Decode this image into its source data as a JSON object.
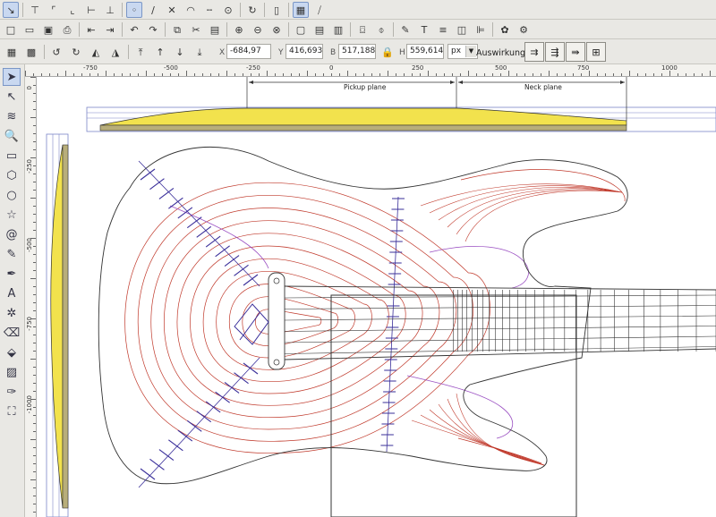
{
  "toolbar1": {
    "icons": [
      "node-snap-icon",
      "snap-bbox-icon",
      "snap-edge-icon",
      "snap-corner-icon",
      "snap-midpoint-icon",
      "snap-center-icon",
      "snap-node-icon",
      "snap-path-icon",
      "snap-intersection-icon",
      "snap-smooth-icon",
      "snap-line-midpoint-icon",
      "snap-object-center-icon",
      "snap-rotation-icon",
      "snap-page-icon",
      "snap-grid-icon",
      "snap-guide-icon"
    ]
  },
  "toolbar2": {
    "icons": [
      "new-icon",
      "open-icon",
      "save-icon",
      "print-icon",
      "import-icon",
      "export-icon",
      "undo-icon",
      "redo-icon",
      "copy-icon",
      "cut-icon",
      "paste-icon",
      "zoom-selection-icon",
      "zoom-drawing-icon",
      "zoom-page-icon",
      "duplicate-icon",
      "clone-icon",
      "unlink-clone-icon",
      "group-icon",
      "ungroup-icon",
      "fill-stroke-icon",
      "text-font-icon",
      "layers-icon",
      "xml-editor-icon",
      "align-icon",
      "preferences-icon",
      "document-properties-icon"
    ]
  },
  "toolbar3": {
    "x_label": "X",
    "x_value": "-684,97",
    "y_label": "Y",
    "y_value": "416,693",
    "w_label": "B",
    "w_value": "517,188",
    "h_label": "H",
    "h_value": "559,614",
    "unit": "px",
    "effect_label": "Auswirkung:"
  },
  "tools": [
    "select-tool",
    "node-tool",
    "tweak-tool",
    "zoom-tool",
    "rectangle-tool",
    "3d-box-tool",
    "ellipse-tool",
    "star-tool",
    "spiral-tool",
    "pencil-tool",
    "calligraphy-tool",
    "text-tool",
    "spray-tool",
    "eraser-tool",
    "paint-bucket-tool",
    "gradient-tool",
    "dropper-tool",
    "connector-tool"
  ],
  "ruler": {
    "h_labels": [
      "-750",
      "-500",
      "-250",
      "0",
      "250",
      "500",
      "750",
      "1000"
    ],
    "v_labels": [
      "0",
      "-250",
      "-500",
      "-750",
      "-1000"
    ]
  },
  "drawing": {
    "pickup_plane_label": "Pickup plane",
    "neck_plane_label": "Neck plane",
    "colors": {
      "body_outline": "#333333",
      "contour_lines": "#c0392b",
      "ribs": "#3a2f9a",
      "violet_lines": "#9a4fc2",
      "fill_yellow": "#f2e24d",
      "fill_olive": "#b8ae7a"
    }
  }
}
